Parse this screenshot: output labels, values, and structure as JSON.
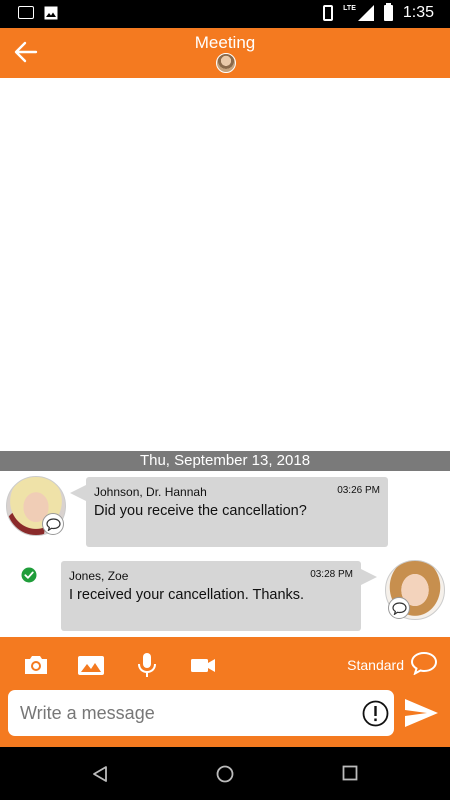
{
  "status_bar": {
    "time": "1:35",
    "network": "LTE",
    "icons": [
      "notification-icon",
      "image-icon",
      "vibrate-icon",
      "signal-icon",
      "battery-icon"
    ]
  },
  "header": {
    "title": "Meeting",
    "back_icon": "arrow-left-icon",
    "color": "#f47a20"
  },
  "chat": {
    "date_separator": "Thu, September 13, 2018",
    "messages": [
      {
        "sender": "Johnson, Dr. Hannah",
        "time": "03:26 PM",
        "text": "Did you receive the cancellation?",
        "direction": "incoming"
      },
      {
        "sender": "Jones, Zoe",
        "time": "03:28 PM",
        "text": "I received your cancellation. Thanks.",
        "direction": "outgoing",
        "status": "read"
      }
    ]
  },
  "compose": {
    "tools": [
      "camera-icon",
      "gallery-icon",
      "microphone-icon",
      "video-icon"
    ],
    "priority_label": "Standard",
    "placeholder": "Write a message",
    "urgent_icon": "exclamation-icon",
    "send_icon": "send-icon"
  },
  "nav_bar": {
    "buttons": [
      "back-triangle-icon",
      "home-circle-icon",
      "recents-square-icon"
    ]
  },
  "colors": {
    "accent": "#f47a20",
    "bubble": "#d6d6d6",
    "date_bar": "#7a7a7a",
    "read_check": "#1f9d3a"
  }
}
